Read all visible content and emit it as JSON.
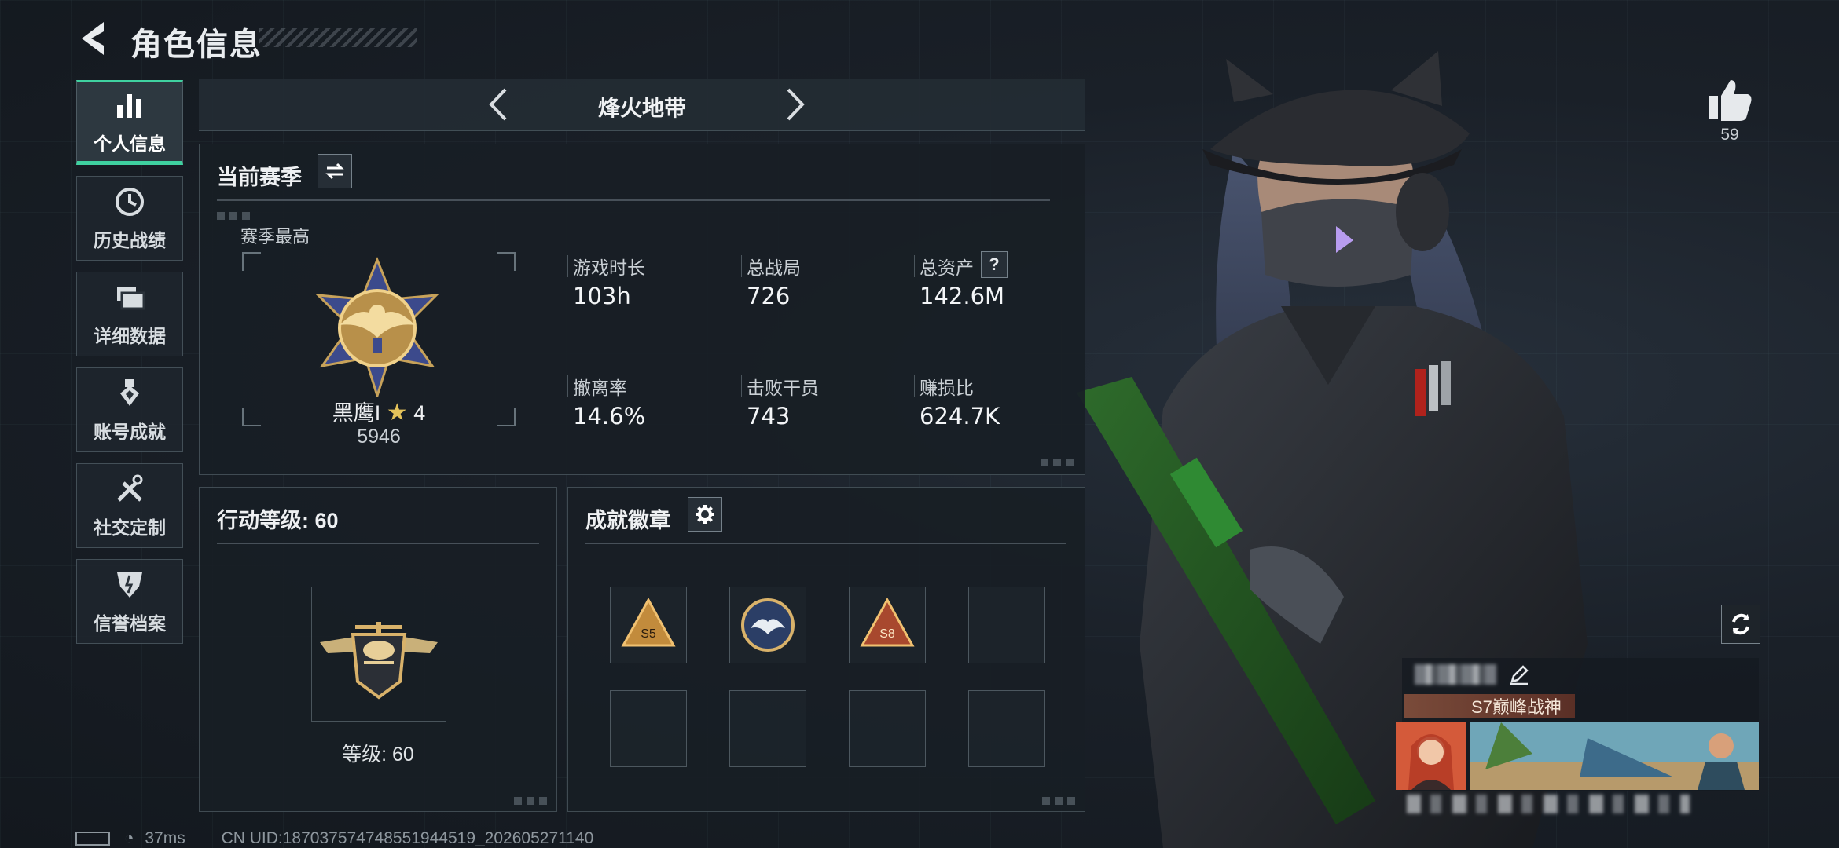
{
  "header": {
    "title": "角色信息"
  },
  "sidebar": {
    "items": [
      {
        "label": "个人信息",
        "icon": "bar-chart-icon",
        "active": true
      },
      {
        "label": "历史战绩",
        "icon": "history-clock-icon",
        "active": false
      },
      {
        "label": "详细数据",
        "icon": "folder-stack-icon",
        "active": false
      },
      {
        "label": "账号成就",
        "icon": "achievement-medal-icon",
        "active": false
      },
      {
        "label": "社交定制",
        "icon": "tools-cross-icon",
        "active": false
      },
      {
        "label": "信誉档案",
        "icon": "shield-badge-icon",
        "active": false
      }
    ]
  },
  "mode": {
    "title": "烽火地带"
  },
  "season_panel": {
    "title": "当前赛季",
    "best_label": "赛季最高",
    "rank_name": "黑鹰I",
    "rank_stars": "4",
    "rank_points": "5946",
    "stats": [
      {
        "label": "游戏时长",
        "value": "103h"
      },
      {
        "label": "总战局",
        "value": "726"
      },
      {
        "label": "总资产",
        "value": "142.6M",
        "help": "?"
      },
      {
        "label": "撤离率",
        "value": "14.6%"
      },
      {
        "label": "击败干员",
        "value": "743"
      },
      {
        "label": "赚损比",
        "value": "624.7K"
      }
    ]
  },
  "level_panel": {
    "title": "行动等级: 60",
    "level_text": "等级: 60"
  },
  "badge_panel": {
    "title": "成就徽章",
    "slots_filled": 3,
    "slots_total": 8
  },
  "likes": {
    "count": "59"
  },
  "player_card": {
    "title_tag": "S7巅峰战神"
  },
  "footer": {
    "ping": "37ms",
    "uid": "CN UID:187037574748551944519_202605271140"
  },
  "colors": {
    "accent": "#3fd1a0",
    "panel_border": "#8ca0aa",
    "text": "#e6e9ec"
  }
}
